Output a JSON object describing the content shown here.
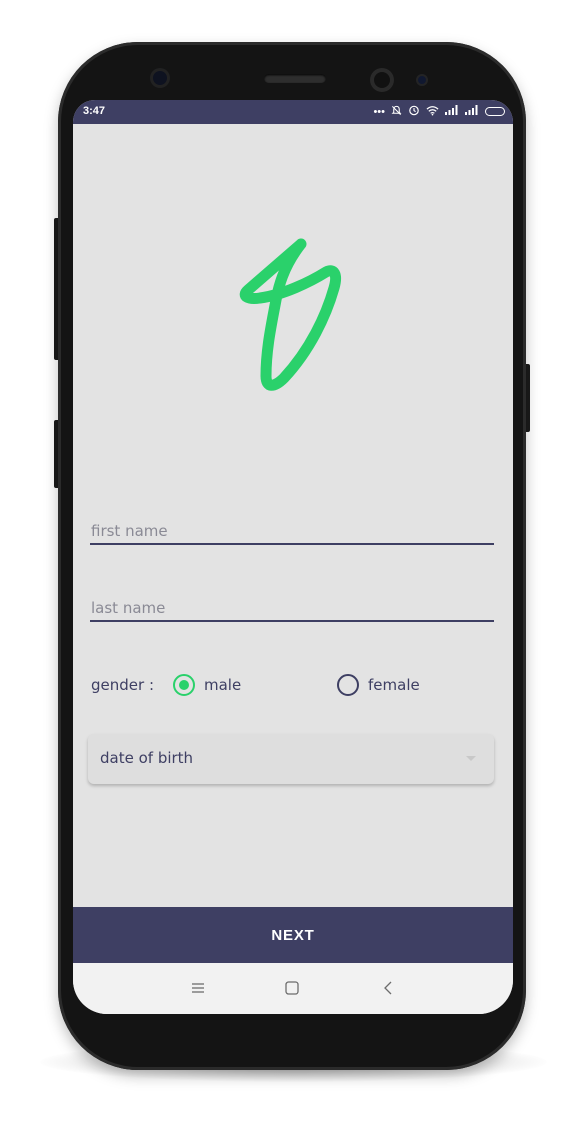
{
  "status_bar": {
    "time": "3:47",
    "icons": [
      "more-icon",
      "mute-icon",
      "alarm-icon",
      "wifi-icon",
      "signal-icon",
      "signal-icon",
      "battery-icon"
    ]
  },
  "form": {
    "first_name": {
      "placeholder": "first name",
      "value": ""
    },
    "last_name": {
      "placeholder": "last name",
      "value": ""
    },
    "gender": {
      "label": "gender :",
      "options": [
        {
          "label": "male",
          "selected": true
        },
        {
          "label": "female",
          "selected": false
        }
      ]
    },
    "dob": {
      "placeholder": "date of birth"
    }
  },
  "next_button": {
    "label": "NEXT"
  },
  "colors": {
    "primary": "#3e3f63",
    "accent": "#2ad16b",
    "background": "#e3e3e3"
  },
  "nav_bar": {
    "icons": [
      "menu-icon",
      "home-icon",
      "back-icon"
    ]
  }
}
